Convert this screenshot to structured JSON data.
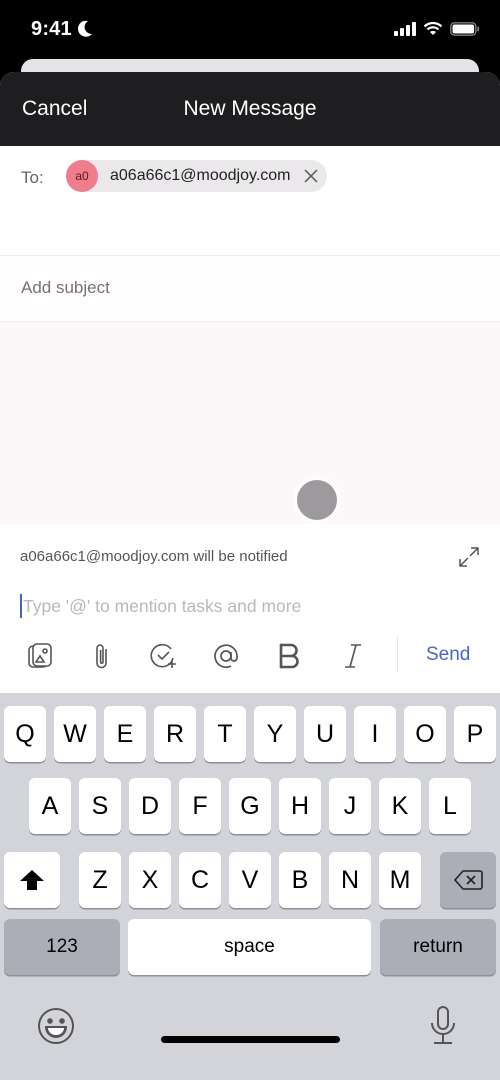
{
  "status_bar": {
    "time": "9:41",
    "icons": [
      "moon-icon",
      "signal-icon",
      "wifi-icon",
      "battery-icon"
    ]
  },
  "nav": {
    "cancel_label": "Cancel",
    "title": "New Message"
  },
  "compose": {
    "to_label": "To:",
    "recipient": {
      "avatar_initials": "a0",
      "avatar_color": "#f07d8c",
      "email": "a06a66c1@moodjoy.com"
    },
    "subject_placeholder": "Add subject",
    "notify_text": "a06a66c1@moodjoy.com will be notified",
    "mention_placeholder": "Type '@' to mention tasks and more"
  },
  "toolbar": {
    "items": [
      "photo-icon",
      "attachment-icon",
      "task-add-icon",
      "mention-icon",
      "bold-icon",
      "italic-icon"
    ],
    "send_label": "Send",
    "accent": "#4a66c6"
  },
  "keyboard": {
    "row1": [
      "Q",
      "W",
      "E",
      "R",
      "T",
      "Y",
      "U",
      "I",
      "O",
      "P"
    ],
    "row2": [
      "A",
      "S",
      "D",
      "F",
      "G",
      "H",
      "J",
      "K",
      "L"
    ],
    "row3": [
      "Z",
      "X",
      "C",
      "V",
      "B",
      "N",
      "M"
    ],
    "numbers_label": "123",
    "space_label": "space",
    "return_label": "return"
  }
}
